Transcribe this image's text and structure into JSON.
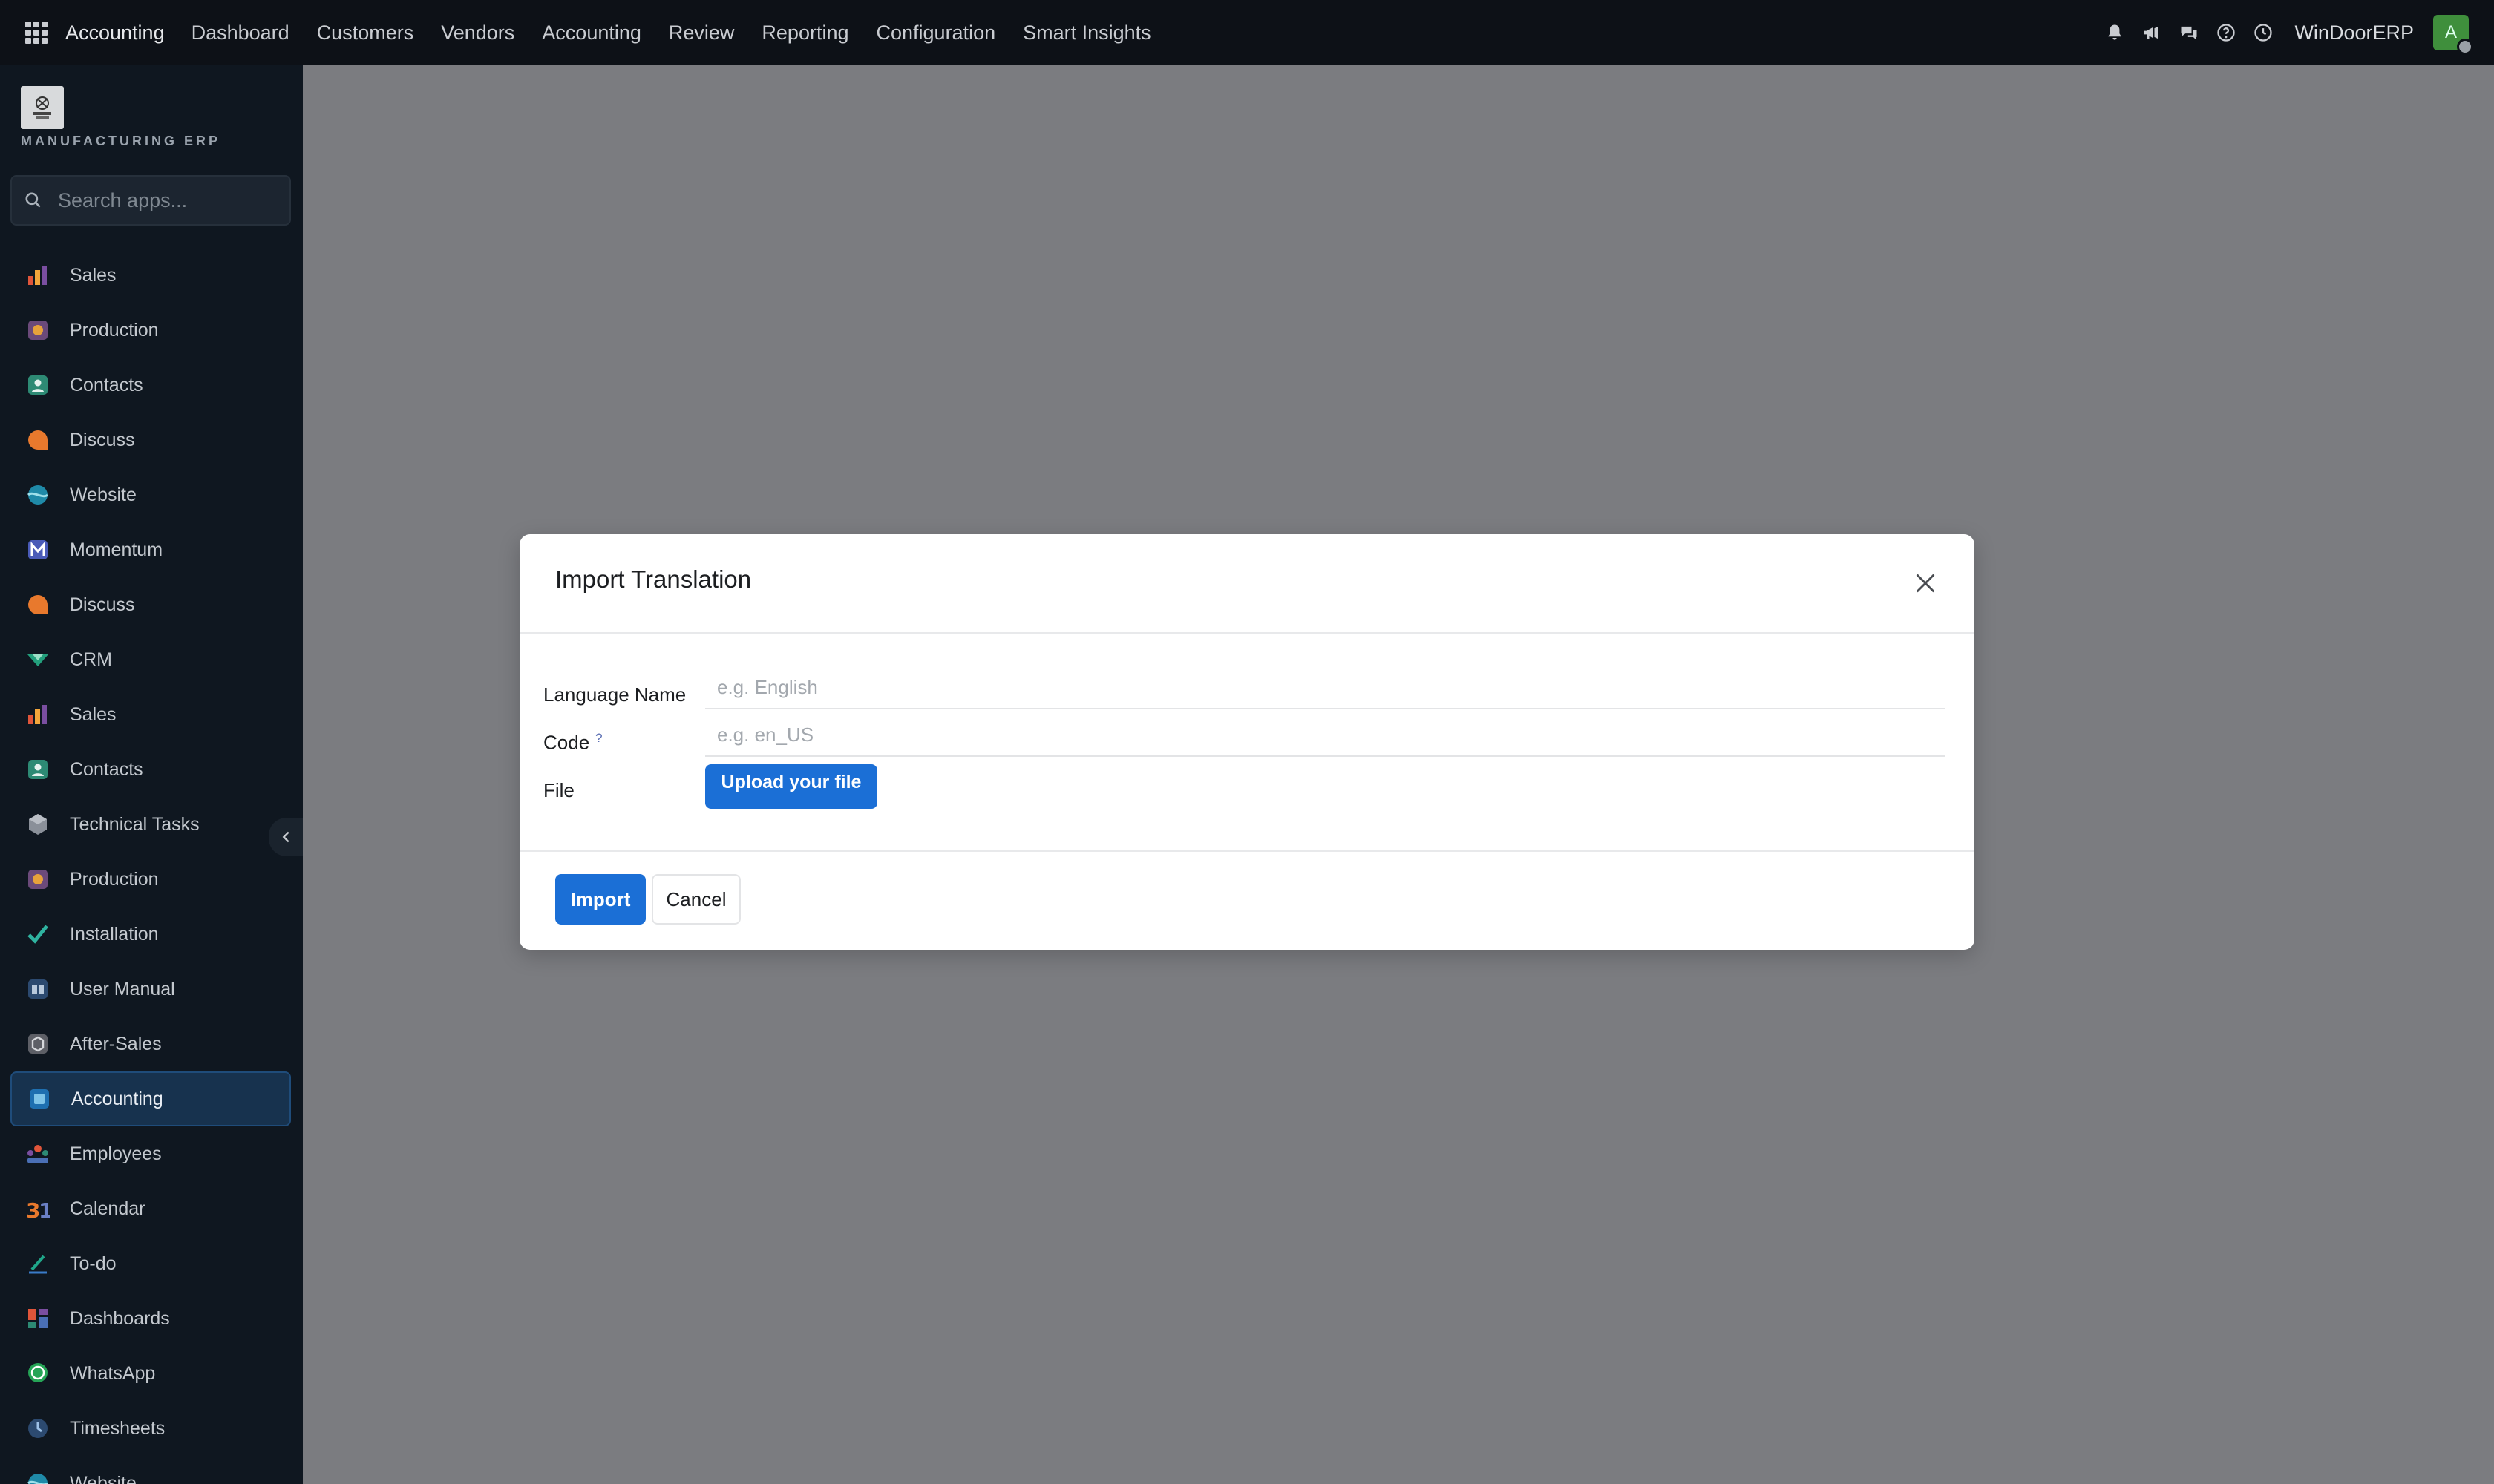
{
  "topbar": {
    "app_name": "Accounting",
    "nav": [
      "Dashboard",
      "Customers",
      "Vendors",
      "Accounting",
      "Review",
      "Reporting",
      "Configuration",
      "Smart Insights"
    ],
    "company": "WinDoorERP",
    "avatar_letter": "A"
  },
  "sidebar": {
    "logo_text": "MANUFACTURING ERP",
    "search_placeholder": "Search apps...",
    "items": [
      {
        "label": "Sales",
        "icon": "sales-icon"
      },
      {
        "label": "Production",
        "icon": "production-icon"
      },
      {
        "label": "Contacts",
        "icon": "contacts-icon"
      },
      {
        "label": "Discuss",
        "icon": "discuss-icon"
      },
      {
        "label": "Website",
        "icon": "website-icon"
      },
      {
        "label": "Momentum",
        "icon": "momentum-icon"
      },
      {
        "label": "Discuss",
        "icon": "discuss-icon"
      },
      {
        "label": "CRM",
        "icon": "crm-icon"
      },
      {
        "label": "Sales",
        "icon": "sales-icon"
      },
      {
        "label": "Contacts",
        "icon": "contacts-icon"
      },
      {
        "label": "Technical Tasks",
        "icon": "technical-tasks-icon"
      },
      {
        "label": "Production",
        "icon": "production-icon"
      },
      {
        "label": "Installation",
        "icon": "installation-icon"
      },
      {
        "label": "User Manual",
        "icon": "user-manual-icon"
      },
      {
        "label": "After-Sales",
        "icon": "after-sales-icon"
      },
      {
        "label": "Accounting",
        "icon": "accounting-icon",
        "active": true
      },
      {
        "label": "Employees",
        "icon": "employees-icon"
      },
      {
        "label": "Calendar",
        "icon": "calendar-icon"
      },
      {
        "label": "To-do",
        "icon": "todo-icon"
      },
      {
        "label": "Dashboards",
        "icon": "dashboards-icon"
      },
      {
        "label": "WhatsApp",
        "icon": "whatsapp-icon"
      },
      {
        "label": "Timesheets",
        "icon": "timesheets-icon"
      },
      {
        "label": "Website",
        "icon": "website-icon"
      }
    ]
  },
  "modal": {
    "title": "Import Translation",
    "fields": {
      "language_name_label": "Language Name",
      "language_name_placeholder": "e.g. English",
      "code_label": "Code",
      "code_help": "?",
      "code_placeholder": "e.g. en_US",
      "file_label": "File",
      "upload_label": "Upload your file"
    },
    "import_label": "Import",
    "cancel_label": "Cancel"
  },
  "colors": {
    "primary": "#1b6fd6",
    "topbar_bg": "#0d1117",
    "sidebar_bg": "#0f1720",
    "backdrop": "#7b7c80"
  }
}
